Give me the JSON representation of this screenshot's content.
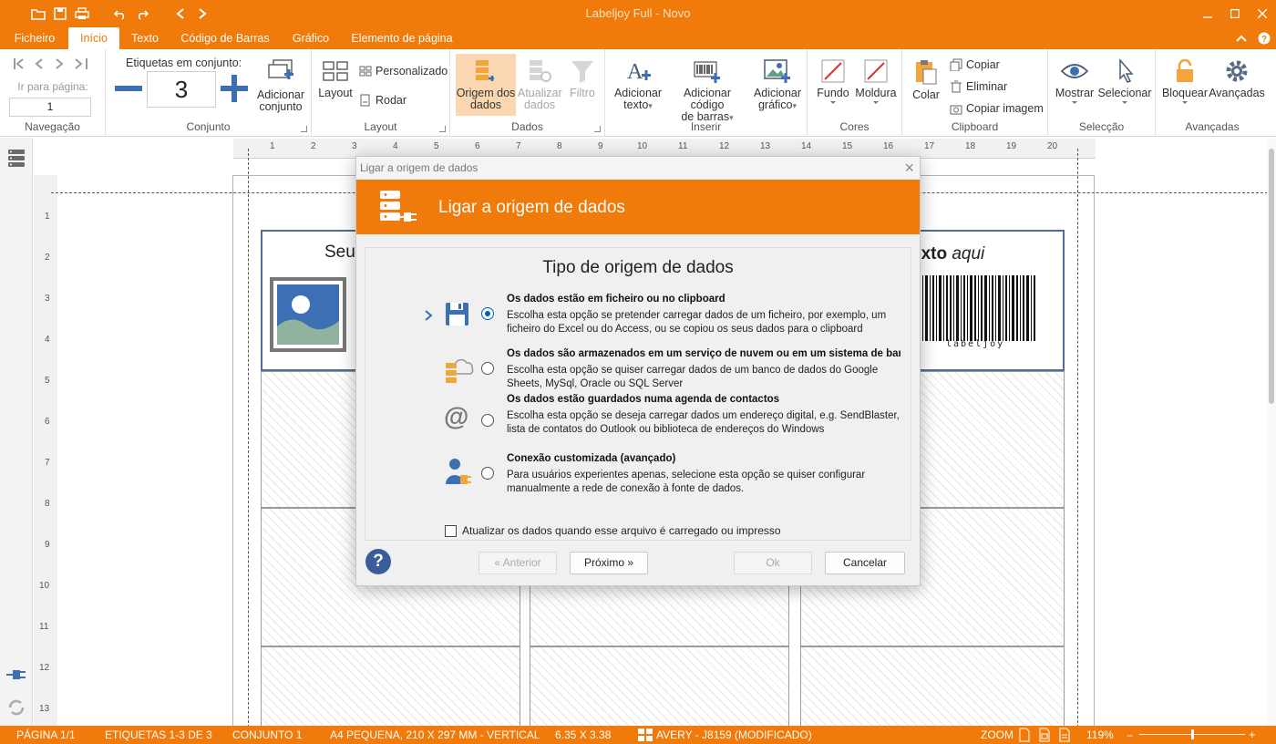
{
  "app": {
    "title": "Labeljoy Full - Novo"
  },
  "menu": {
    "tabs": [
      "Ficheiro",
      "Início",
      "Texto",
      "Código de Barras",
      "Gráfico",
      "Elemento de página"
    ],
    "active": "Início"
  },
  "ribbon": {
    "navegacao": {
      "label": "Navegação",
      "page_prompt": "Ir para página:",
      "page_value": "1"
    },
    "conjunto": {
      "label": "Conjunto",
      "prompt": "Etiquetas em conjunto:",
      "value": "3",
      "add_line1": "Adicionar",
      "add_line2": "conjunto"
    },
    "layout": {
      "label": "Layout",
      "layout_btn": "Layout",
      "personalizado": "Personalizado",
      "rodar": "Rodar"
    },
    "dados": {
      "label": "Dados",
      "origem_l1": "Origem dos",
      "origem_l2": "dados",
      "atualizar_l1": "Atualizar",
      "atualizar_l2": "dados",
      "filtro": "Filtro"
    },
    "inserir": {
      "label": "Inserir",
      "texto_l1": "Adicionar",
      "texto_l2": "texto",
      "codigo_l1": "Adicionar código",
      "codigo_l2": "de barras",
      "grafico_l1": "Adicionar",
      "grafico_l2": "gráfico"
    },
    "cores": {
      "label": "Cores",
      "fundo": "Fundo",
      "moldura": "Moldura"
    },
    "clipboard": {
      "label": "Clipboard",
      "colar": "Colar",
      "copiar": "Copiar",
      "eliminar": "Eliminar",
      "copiar_imagem": "Copiar imagem"
    },
    "seleccao": {
      "label": "Selecção",
      "mostrar": "Mostrar",
      "selecionar": "Selecionar"
    },
    "avancadas": {
      "label": "Avançadas",
      "bloquear": "Bloquear",
      "avancadas": "Avançadas"
    }
  },
  "label_preview": {
    "left_text": "Seu",
    "right_text_bold": "exto",
    "right_text_italic": "aqui",
    "barcode_caption": "labeljoy"
  },
  "dialog": {
    "window_title": "Ligar a origem de dados",
    "header_title": "Ligar a origem de dados",
    "panel_title": "Tipo de origem de dados",
    "options": [
      {
        "title": "Os dados estão em ficheiro ou no clipboard",
        "desc": "Escolha esta opção se pretender carregar dados de um ficheiro, por exemplo, um ficheiro do Excel ou do Access, ou se copiou os seus dados para o clipboard",
        "selected": true
      },
      {
        "title": "Os dados são armazenados em um serviço de nuvem ou em um sistema de bar",
        "desc": "Escolha esta opção se quiser carregar dados de um banco de dados do Google Sheets, MySql, Oracle ou SQL Server",
        "selected": false
      },
      {
        "title": "Os dados estão guardados numa agenda de contactos",
        "desc": "Escolha esta opção se deseja carregar dados um endereço digital, e.g. SendBlaster, lista de contatos do Outlook ou biblioteca de endereços do Windows",
        "selected": false
      },
      {
        "title": "Conexão customizada (avançado)",
        "desc": "Para usuários experientes apenas, selecione esta opção se quiser configurar manualmente a rede de conexão à fonte de dados.",
        "selected": false
      }
    ],
    "checkbox_label": "Atualizar os dados quando esse arquivo é carregado ou impresso",
    "buttons": {
      "prev": "« Anterior",
      "next": "Próximo »",
      "ok": "Ok",
      "cancel": "Cancelar"
    }
  },
  "statusbar": {
    "pagina": "PÁGINA 1/1",
    "etiquetas": "ETIQUETAS 1-3 DE 3",
    "conjunto": "CONJUNTO 1",
    "papel": "A4 PEQUENA, 210 X 297 MM - VERTICAL",
    "tamanho": "6.35 X 3.38",
    "modelo": "AVERY - J8159 (MODIFICADO)",
    "zoom_label": "ZOOM",
    "zoom_value": "119%"
  },
  "rulers": {
    "h": [
      "1",
      "2",
      "3",
      "4",
      "5",
      "6",
      "7",
      "8",
      "9",
      "10",
      "11",
      "12",
      "13",
      "14",
      "15",
      "16",
      "17",
      "18",
      "19",
      "20"
    ],
    "v": [
      "1",
      "2",
      "3",
      "4",
      "5",
      "6",
      "7",
      "8",
      "9",
      "10",
      "11",
      "12",
      "13"
    ]
  },
  "colors": {
    "accent": "#f07a0a",
    "link_blue": "#0060c0"
  }
}
